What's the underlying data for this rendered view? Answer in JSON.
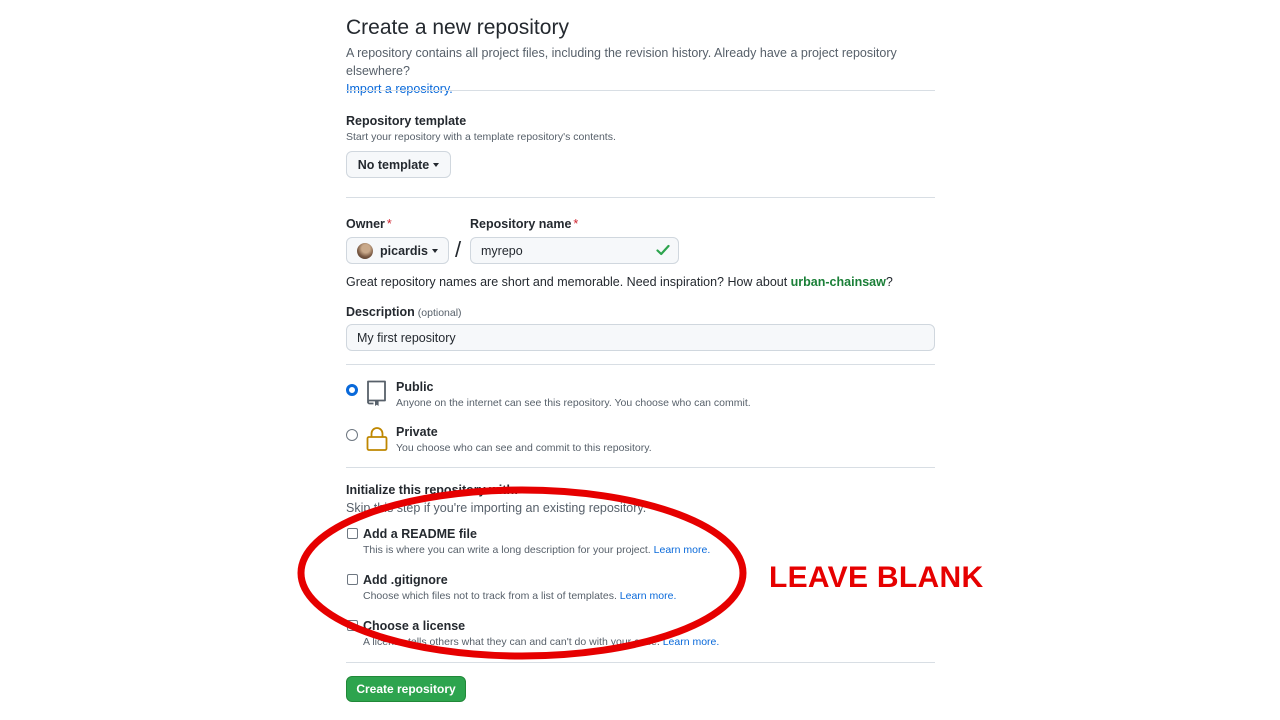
{
  "header": {
    "title": "Create a new repository",
    "subtitle": "A repository contains all project files, including the revision history. Already have a project repository elsewhere?",
    "import_link": "Import a repository."
  },
  "template": {
    "label": "Repository template",
    "note": "Start your repository with a template repository's contents.",
    "button_label": "No template"
  },
  "owner": {
    "label": "Owner",
    "required_mark": "*",
    "value": "picardis"
  },
  "repo_name": {
    "label": "Repository name",
    "required_mark": "*",
    "value": "myrepo",
    "separator": "/"
  },
  "name_hint": {
    "text": "Great repository names are short and memorable. Need inspiration? How about ",
    "suggestion": "urban-chainsaw",
    "suffix": "?"
  },
  "description": {
    "label": "Description",
    "optional_label": "(optional)",
    "value": "My first repository"
  },
  "visibility": {
    "public": {
      "title": "Public",
      "description": "Anyone on the internet can see this repository. You choose who can commit.",
      "selected": true
    },
    "private": {
      "title": "Private",
      "description": "You choose who can see and commit to this repository.",
      "selected": false
    }
  },
  "initialize": {
    "heading": "Initialize this repository with:",
    "note": "Skip this step if you're importing an existing repository.",
    "options": [
      {
        "title": "Add a README file",
        "description": "This is where you can write a long description for your project.",
        "link": "Learn more."
      },
      {
        "title": "Add .gitignore",
        "description": "Choose which files not to track from a list of templates.",
        "link": "Learn more."
      },
      {
        "title": "Choose a license",
        "description": "A license tells others what they can and can't do with your code.",
        "link": "Learn more."
      }
    ]
  },
  "submit": {
    "label": "Create repository"
  },
  "annotation": {
    "text": "LEAVE BLANK",
    "color": "#e60000"
  },
  "colors": {
    "accent": "#0969da",
    "success": "#2da44e",
    "danger": "#cf222e",
    "private_icon": "#bf8700"
  },
  "icons": [
    "repo-icon",
    "lock-icon",
    "check-icon",
    "caret-down-icon",
    "avatar"
  ]
}
